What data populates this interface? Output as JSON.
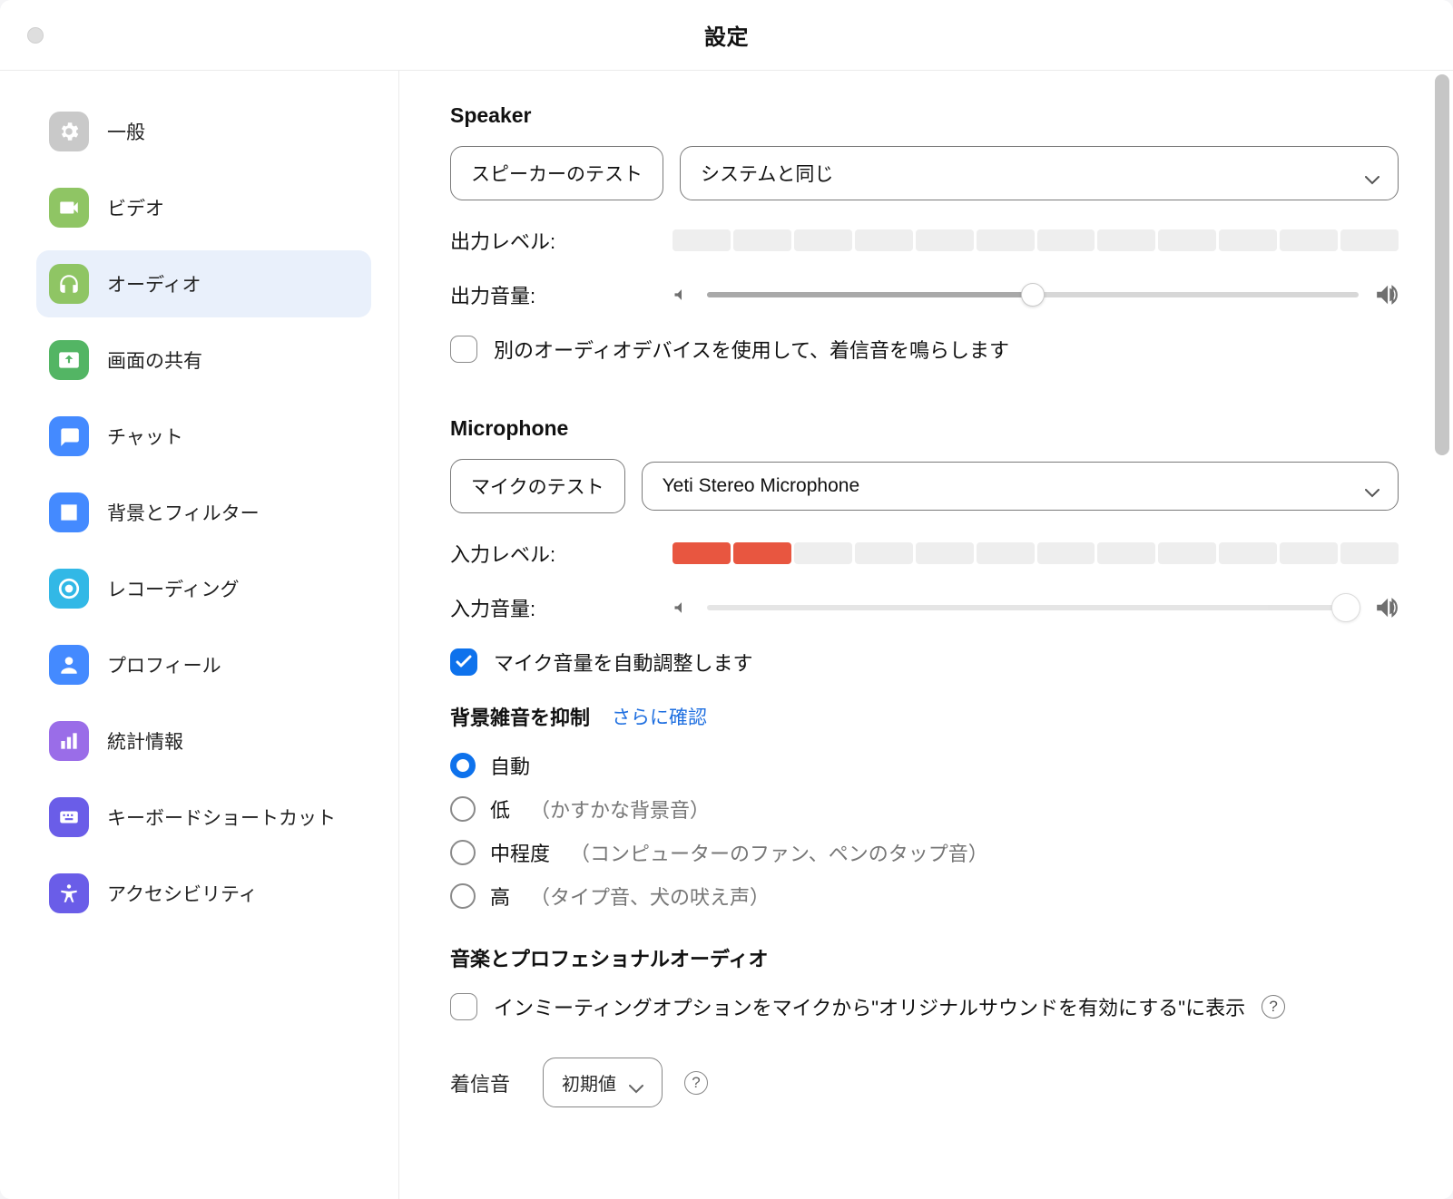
{
  "window": {
    "title": "設定"
  },
  "sidebar": {
    "items": [
      {
        "label": "一般",
        "color": "#c9c9c9"
      },
      {
        "label": "ビデオ",
        "color": "#8fc564"
      },
      {
        "label": "オーディオ",
        "color": "#8fc564"
      },
      {
        "label": "画面の共有",
        "color": "#53b564"
      },
      {
        "label": "チャット",
        "color": "#448aff"
      },
      {
        "label": "背景とフィルター",
        "color": "#448aff"
      },
      {
        "label": "レコーディング",
        "color": "#32b8e6"
      },
      {
        "label": "プロフィール",
        "color": "#448aff"
      },
      {
        "label": "統計情報",
        "color": "#9a6de8"
      },
      {
        "label": "キーボードショートカット",
        "color": "#6a5de8"
      },
      {
        "label": "アクセシビリティ",
        "color": "#6a5de8"
      }
    ]
  },
  "speaker": {
    "title": "Speaker",
    "test_label": "スピーカーのテスト",
    "device": "システムと同じ",
    "output_level_label": "出力レベル:",
    "output_level_on": 0,
    "output_level_total": 12,
    "output_volume_label": "出力音量:",
    "output_volume_percent": 50,
    "separate_device_label": "別のオーディオデバイスを使用して、着信音を鳴らします",
    "separate_device_checked": false
  },
  "microphone": {
    "title": "Microphone",
    "test_label": "マイクのテスト",
    "device": "Yeti Stereo Microphone",
    "input_level_label": "入力レベル:",
    "input_level_on": 2,
    "input_level_total": 12,
    "input_volume_label": "入力音量:",
    "input_volume_percent": 98,
    "auto_adjust_label": "マイク音量を自動調整します",
    "auto_adjust_checked": true
  },
  "noise": {
    "title": "背景雑音を抑制",
    "link": "さらに確認",
    "options": [
      {
        "label": "自動",
        "hint": "",
        "checked": true
      },
      {
        "label": "低",
        "hint": "（かすかな背景音）",
        "checked": false
      },
      {
        "label": "中程度",
        "hint": "（コンピューターのファン、ペンのタップ音）",
        "checked": false
      },
      {
        "label": "高",
        "hint": "（タイプ音、犬の吠え声）",
        "checked": false
      }
    ]
  },
  "music": {
    "title": "音楽とプロフェショナルオーディオ",
    "original_sound_label": "インミーティングオプションをマイクから\"オリジナルサウンドを有効にする\"に表示",
    "original_sound_checked": false
  },
  "ringtone": {
    "label": "着信音",
    "value": "初期値"
  }
}
